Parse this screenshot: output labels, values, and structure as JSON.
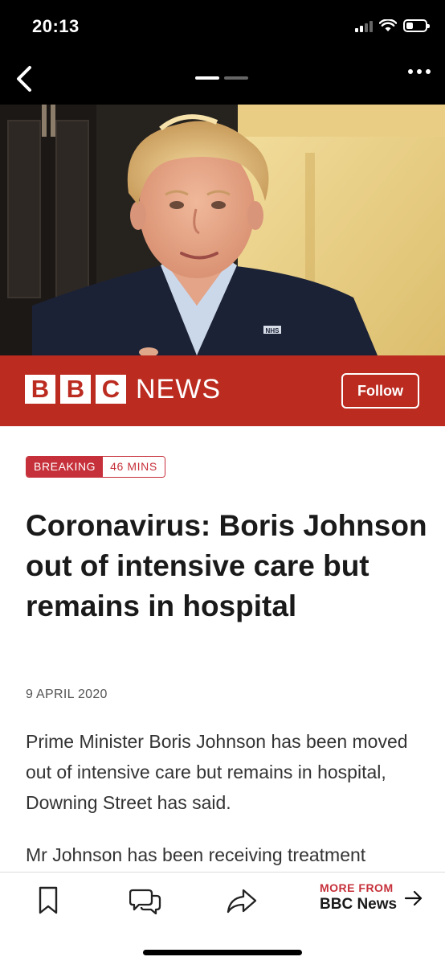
{
  "status_bar": {
    "time": "20:13",
    "battery_level": 0.35,
    "signal_bars": 2
  },
  "nav": {
    "back_icon": "chevron-left-icon",
    "more_icon": "ellipsis-icon",
    "pages": 2,
    "current_page": 1
  },
  "hero": {
    "badge_text": "NHS"
  },
  "banner": {
    "logo_letters": [
      "B",
      "B",
      "C"
    ],
    "logo_word": "NEWS",
    "follow_label": "Follow",
    "color": "#bb2b20"
  },
  "article": {
    "badge_breaking": "BREAKING",
    "badge_time": "46 MINS",
    "headline": "Coronavirus: Boris Johnson out of intensive care but remains in hospital",
    "date": "9 APRIL 2020",
    "paragraphs": [
      "Prime Minister Boris Johnson has been moved out of intensive care but remains in hospital, Downing Street has said.",
      "Mr Johnson has been receiving treatment"
    ],
    "accent": "#c6303a"
  },
  "toolbar": {
    "bookmark_icon": "bookmark-icon",
    "comment_icon": "comments-icon",
    "share_icon": "share-icon",
    "more_from_label": "MORE FROM",
    "more_from_name": "BBC News",
    "arrow_icon": "arrow-right-icon"
  }
}
